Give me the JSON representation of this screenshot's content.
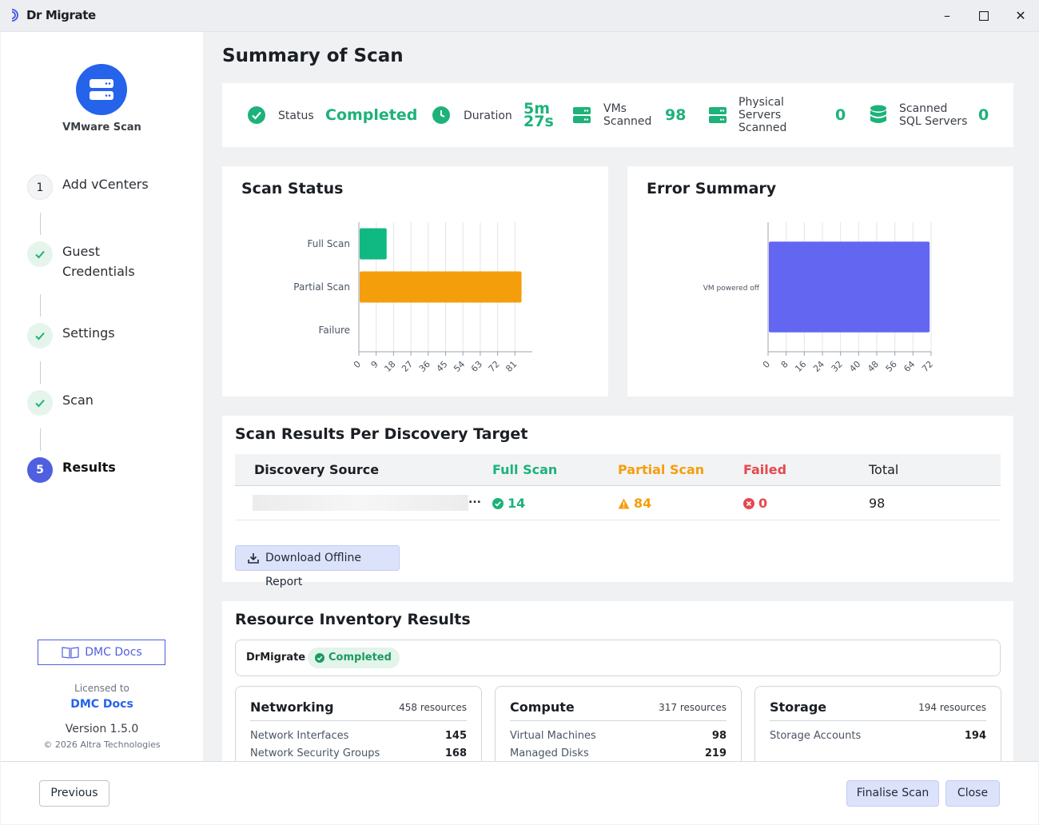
{
  "window": {
    "title": "Dr Migrate",
    "controls": [
      "minimize",
      "maximize",
      "close"
    ]
  },
  "sidebar": {
    "scan_type": "VMware Scan",
    "steps": [
      {
        "num": "1",
        "label": "Add vCenters",
        "state": "pending"
      },
      {
        "num": "",
        "label": "Guest Credentials",
        "state": "done"
      },
      {
        "num": "",
        "label": "Settings",
        "state": "done"
      },
      {
        "num": "",
        "label": "Scan",
        "state": "done"
      },
      {
        "num": "5",
        "label": "Results",
        "state": "active"
      }
    ],
    "docs_button": "DMC Docs",
    "licensed_to_label": "Licensed to",
    "licensed_to": "DMC Docs",
    "version": "Version 1.5.0",
    "copyright": "© 2026 Altra Technologies"
  },
  "main": {
    "title": "Summary of Scan",
    "stats": {
      "status_label": "Status",
      "status_value": "Completed",
      "duration_label": "Duration",
      "duration_value_1": "5m",
      "duration_value_2": "27s",
      "vms_label_1": "VMs",
      "vms_label_2": "Scanned",
      "vms_value": "98",
      "phys_label_1": "Physical",
      "phys_label_2": "Servers",
      "phys_label_3": "Scanned",
      "phys_value": "0",
      "sql_label_1": "Scanned",
      "sql_label_2": "SQL Servers",
      "sql_value": "0"
    },
    "scan_status_title": "Scan Status",
    "error_summary_title": "Error Summary",
    "results_title": "Scan Results Per Discovery Target",
    "results_table": {
      "headers": {
        "source": "Discovery Source",
        "full": "Full Scan",
        "partial": "Partial Scan",
        "failed": "Failed",
        "total": "Total"
      },
      "rows": [
        {
          "source": "...",
          "full": "14",
          "partial": "84",
          "failed": "0",
          "total": "98"
        }
      ]
    },
    "download_button": "Download Offline Report",
    "inventory_title": "Resource Inventory Results",
    "inventory_source": "DrMigrate",
    "inventory_status": "Completed",
    "resource_groups": [
      {
        "title": "Networking",
        "count": "458 resources",
        "items": [
          {
            "name": "Network Interfaces",
            "value": "145"
          },
          {
            "name": "Network Security Groups",
            "value": "168"
          }
        ]
      },
      {
        "title": "Compute",
        "count": "317 resources",
        "items": [
          {
            "name": "Virtual Machines",
            "value": "98"
          },
          {
            "name": "Managed Disks",
            "value": "219"
          }
        ]
      },
      {
        "title": "Storage",
        "count": "194 resources",
        "items": [
          {
            "name": "Storage Accounts",
            "value": "194"
          }
        ]
      }
    ]
  },
  "footer": {
    "previous": "Previous",
    "finalise": "Finalise Scan",
    "close": "Close"
  },
  "colors": {
    "success": "#1db27a",
    "warning": "#f59e0b",
    "error": "#dc2626",
    "accent": "#4f5fe0",
    "brand_blue": "#2563eb",
    "error_bar": "#6366f1"
  },
  "chart_data": [
    {
      "type": "bar",
      "orientation": "horizontal",
      "title": "Scan Status",
      "categories": [
        "Full Scan",
        "Partial Scan",
        "Failure"
      ],
      "values": [
        14,
        84,
        0
      ],
      "colors": [
        "#10b981",
        "#f59e0b",
        "#ef4444"
      ],
      "xticks": [
        0,
        9,
        18,
        27,
        36,
        45,
        54,
        63,
        72,
        81
      ],
      "xlim": [
        0,
        90
      ],
      "grid": true
    },
    {
      "type": "bar",
      "orientation": "horizontal",
      "title": "Error Summary",
      "categories": [
        "VM powered off"
      ],
      "values": [
        71
      ],
      "colors": [
        "#6366f1"
      ],
      "xticks": [
        0,
        8,
        16,
        24,
        32,
        40,
        48,
        56,
        64,
        72
      ],
      "xlim": [
        0,
        72
      ],
      "grid": true
    }
  ]
}
